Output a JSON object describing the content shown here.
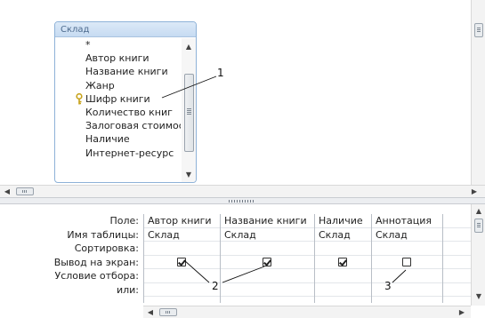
{
  "table_window": {
    "title": "Склад",
    "fields": [
      "*",
      "Автор книги",
      "Название книги",
      "Жанр",
      "Шифр книги",
      "Количество книг",
      "Залоговая стоимость",
      "Наличие",
      "Интернет-ресурс"
    ],
    "key_field_index": 4,
    "key_icon": "key-icon"
  },
  "grid": {
    "row_labels": [
      "Поле:",
      "Имя таблицы:",
      "Сортировка:",
      "Вывод на экран:",
      "Условие отбора:",
      "или:"
    ],
    "columns": [
      {
        "field": "Автор книги",
        "table": "Склад",
        "sort": "",
        "show": true
      },
      {
        "field": "Название книги",
        "table": "Склад",
        "sort": "",
        "show": true
      },
      {
        "field": "Наличие",
        "table": "Склад",
        "sort": "",
        "show": true
      },
      {
        "field": "Аннотация",
        "table": "Склад",
        "sort": "",
        "show": false
      },
      {
        "field": "",
        "table": "",
        "sort": "",
        "show": null
      }
    ]
  },
  "callouts": [
    "1",
    "2",
    "3"
  ],
  "icons": {
    "scroll_up": "up-arrow-icon",
    "scroll_down": "down-arrow-icon",
    "scroll_left": "left-arrow-icon",
    "scroll_right": "right-arrow-icon"
  }
}
